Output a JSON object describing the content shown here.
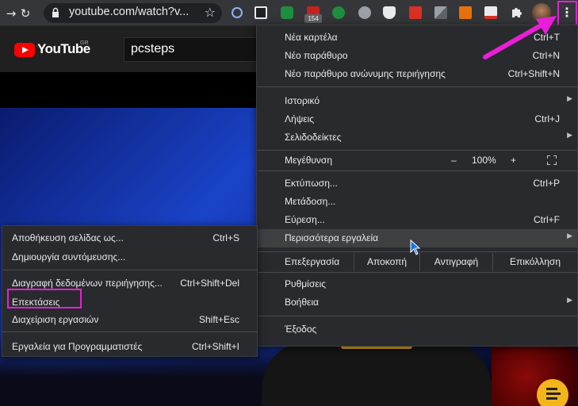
{
  "browser": {
    "url": "youtube.com/watch?v...",
    "toolbar_icons": [
      "back-icon",
      "forward-icon",
      "reload-icon",
      "lock-icon",
      "star-icon",
      "extension-icons",
      "puzzle-icon",
      "avatar",
      "kebab-menu-icon"
    ],
    "extension_badge": "154"
  },
  "youtube": {
    "logo_text": "YouTube",
    "region": "GR",
    "search_value": "pcsteps"
  },
  "menu": {
    "new_tab": {
      "label": "Νέα καρτέλα",
      "shortcut": "Ctrl+T"
    },
    "new_window": {
      "label": "Νέο παράθυρο",
      "shortcut": "Ctrl+N"
    },
    "incognito": {
      "label": "Νέο παράθυρο ανώνυμης περιήγησης",
      "shortcut": "Ctrl+Shift+N"
    },
    "history": {
      "label": "Ιστορικό"
    },
    "downloads": {
      "label": "Λήψεις",
      "shortcut": "Ctrl+J"
    },
    "bookmarks": {
      "label": "Σελιδοδείκτες"
    },
    "zoom": {
      "label": "Μεγέθυνση",
      "minus": "–",
      "value": "100%",
      "plus": "+"
    },
    "print": {
      "label": "Εκτύπωση...",
      "shortcut": "Ctrl+P"
    },
    "cast": {
      "label": "Μετάδοση..."
    },
    "find": {
      "label": "Εύρεση...",
      "shortcut": "Ctrl+F"
    },
    "more_tools": {
      "label": "Περισσότερα εργαλεία"
    },
    "edit": {
      "label": "Επεξεργασία",
      "cut": "Αποκοπή",
      "copy": "Αντιγραφή",
      "paste": "Επικόλληση"
    },
    "settings": {
      "label": "Ρυθμίσεις"
    },
    "help": {
      "label": "Βοήθεια"
    },
    "exit": {
      "label": "Έξοδος"
    }
  },
  "submenu": {
    "save_page": {
      "label": "Αποθήκευση σελίδας ως...",
      "shortcut": "Ctrl+S"
    },
    "create_shortcut": {
      "label": "Δημιουργία συντόμευσης..."
    },
    "clear_data": {
      "label": "Διαγραφή δεδομένων περιήγησης...",
      "shortcut": "Ctrl+Shift+Del"
    },
    "extensions": {
      "label": "Επεκτάσεις"
    },
    "task_manager": {
      "label": "Διαχείριση εργασιών",
      "shortcut": "Shift+Esc"
    },
    "dev_tools": {
      "label": "Εργαλεία για Προγραμματιστές",
      "shortcut": "Ctrl+Shift+I"
    }
  },
  "colors": {
    "menu_bg": "#292a2d",
    "highlight": "#3f4042",
    "annotation": "#e91ed8",
    "youtube_red": "#ff0000"
  }
}
